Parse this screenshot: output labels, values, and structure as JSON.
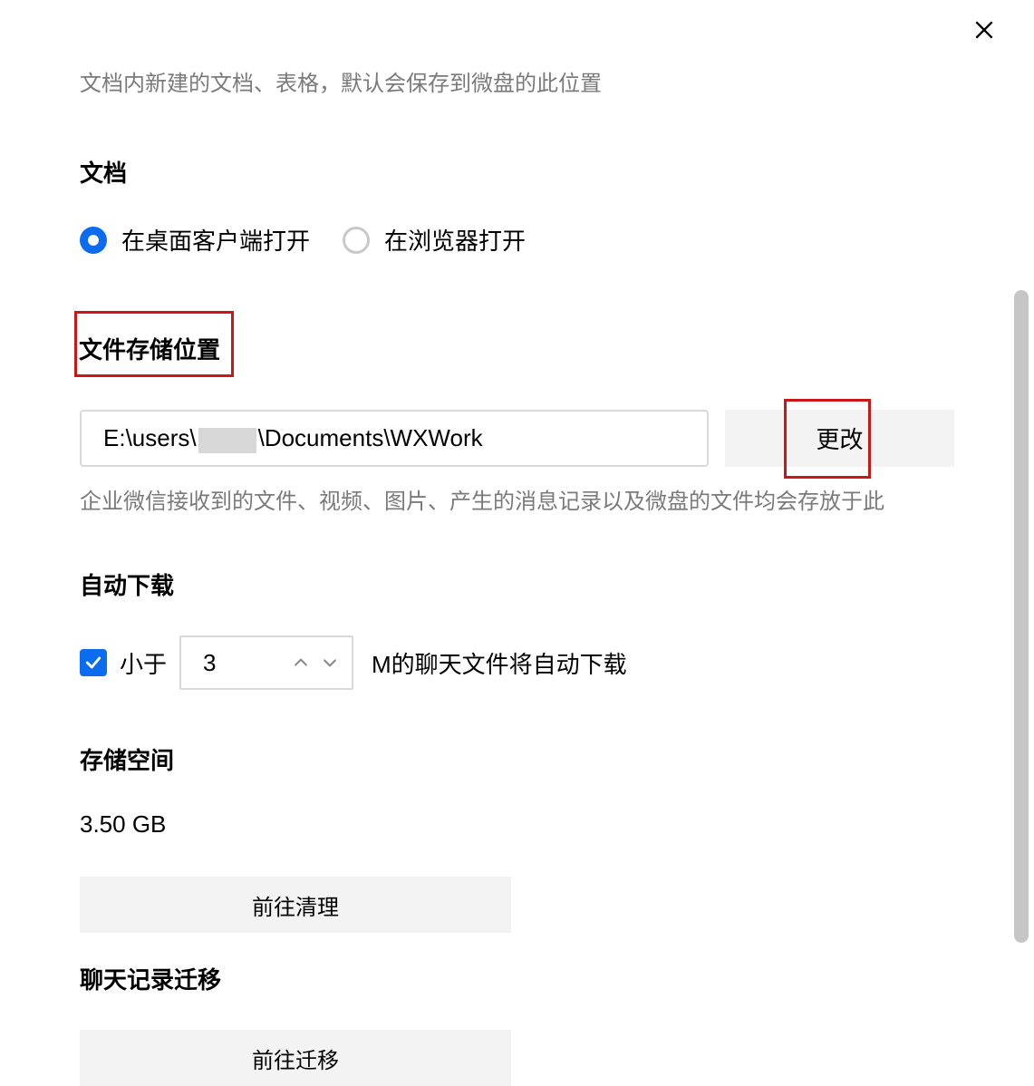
{
  "top_desc": "文档内新建的文档、表格，默认会保存到微盘的此位置",
  "doc_section": {
    "title": "文档",
    "options": [
      {
        "label": "在桌面客户端打开",
        "selected": true
      },
      {
        "label": "在浏览器打开",
        "selected": false
      }
    ]
  },
  "storage_location": {
    "title": "文件存储位置",
    "path_prefix": "E:\\users\\",
    "path_suffix": "\\Documents\\WXWork",
    "change_btn": "更改",
    "desc": "企业微信接收到的文件、视频、图片、产生的消息记录以及微盘的文件均会存放于此"
  },
  "auto_download": {
    "title": "自动下载",
    "checkbox_checked": true,
    "prefix_label": "小于",
    "value": "3",
    "suffix_label": "M的聊天文件将自动下载"
  },
  "storage_space": {
    "title": "存储空间",
    "value": "3.50 GB",
    "clean_btn": "前往清理"
  },
  "chat_migration": {
    "title": "聊天记录迁移",
    "migrate_btn": "前往迁移"
  }
}
